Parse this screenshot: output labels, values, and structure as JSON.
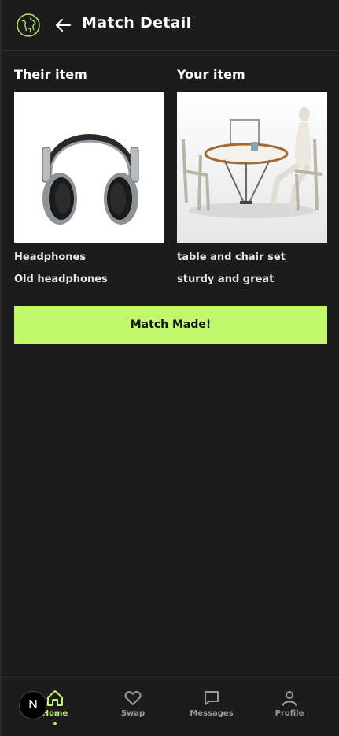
{
  "header": {
    "title": "Match Detail",
    "back_icon": "arrow-left-icon",
    "logo_icon": "globe-logo-icon"
  },
  "their_item": {
    "heading": "Their item",
    "name": "Headphones",
    "description": "Old headphones",
    "image": "headphones-image"
  },
  "your_item": {
    "heading": "Your item",
    "name": "table and chair set",
    "description": "sturdy and great",
    "image": "table-chairs-image"
  },
  "match_button": {
    "label": "Match Made!"
  },
  "nav": {
    "items": [
      {
        "label": "Home",
        "icon": "home-icon",
        "active": true
      },
      {
        "label": "Swap",
        "icon": "heart-icon",
        "active": false
      },
      {
        "label": "Messages",
        "icon": "message-icon",
        "active": false
      },
      {
        "label": "Profile",
        "icon": "user-icon",
        "active": false
      }
    ],
    "badge": "N"
  },
  "colors": {
    "background": "#1c1c1c",
    "accent": "#c2f76c",
    "muted": "#9a9a9a"
  }
}
